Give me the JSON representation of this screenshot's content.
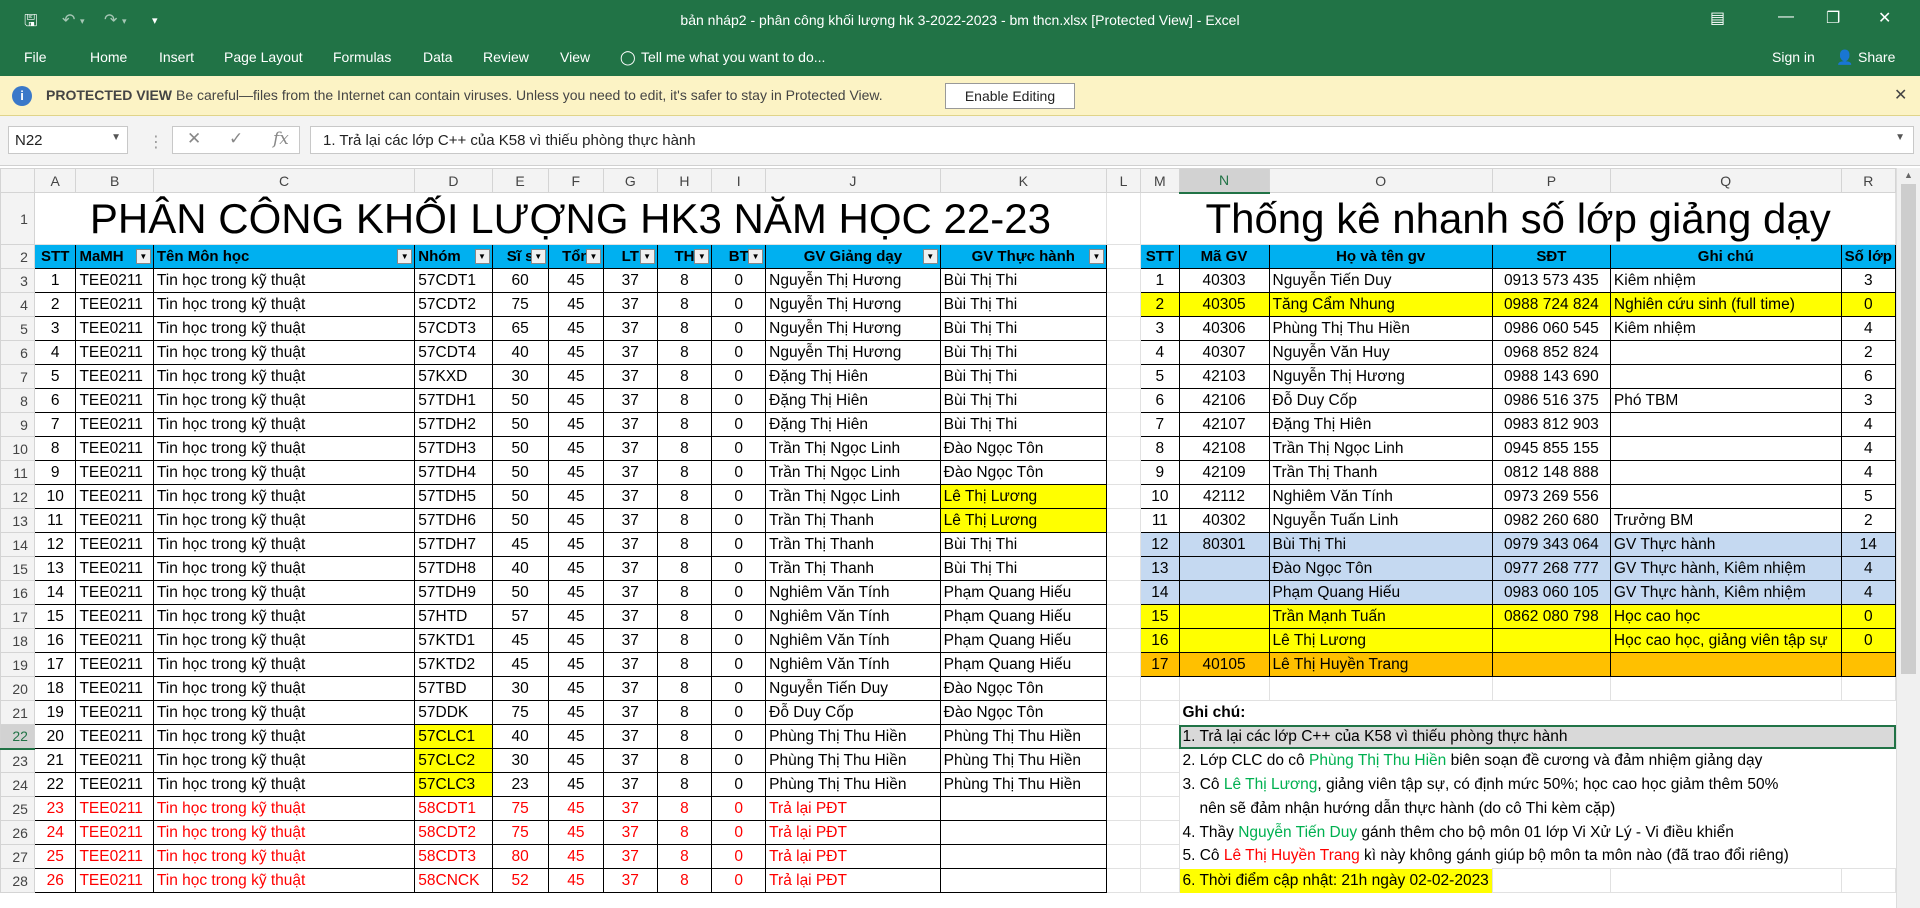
{
  "app": {
    "title": "bản nháp2 - phân công khối lượng hk 3-2022-2023 - bm thcn.xlsx  [Protected View] - Excel"
  },
  "ribbon": {
    "file": "File",
    "tabs": [
      "Home",
      "Insert",
      "Page Layout",
      "Formulas",
      "Data",
      "Review",
      "View"
    ],
    "tell": "Tell me what you want to do...",
    "signin": "Sign in",
    "share": "Share"
  },
  "protected": {
    "label": "PROTECTED VIEW",
    "message": "Be careful—files from the Internet can contain viruses. Unless you need to edit, it's safer to stay in Protected View.",
    "button": "Enable Editing"
  },
  "formula_bar": {
    "name_box": "N22",
    "fx": "fx",
    "content": "1. Trả lại các lớp C++ của K58 vì thiếu phòng thực hành"
  },
  "columns": [
    "A",
    "B",
    "C",
    "D",
    "E",
    "F",
    "G",
    "H",
    "I",
    "J",
    "K",
    "L",
    "M",
    "N",
    "O",
    "P",
    "Q",
    "R"
  ],
  "rows": [
    "1",
    "2",
    "3",
    "4",
    "5",
    "6",
    "7",
    "8",
    "9",
    "10",
    "11",
    "12",
    "13",
    "14",
    "15",
    "16",
    "17",
    "18",
    "19",
    "20",
    "21",
    "22",
    "23",
    "24",
    "25",
    "26",
    "27",
    "28"
  ],
  "title_left": "PHÂN CÔNG KHỐI LƯỢNG HK3 NĂM HỌC 22-23",
  "title_right": "Thống kê nhanh số lớp giảng dạy",
  "headers_left": [
    "STT",
    "MaMH",
    "Tên Môn học",
    "Nhóm",
    "Sĩ s",
    "Tổn",
    "LT",
    "TH",
    "BT",
    "GV Giảng dạy",
    "GV Thực hành"
  ],
  "headers_right": [
    "STT",
    "Mã GV",
    "Họ và tên gv",
    "SĐT",
    "Ghi chú",
    "Số lớp"
  ],
  "assignments": [
    [
      "1",
      "TEE0211",
      "Tin học trong kỹ thuật",
      "57CDT1",
      "60",
      "45",
      "37",
      "8",
      "0",
      "Nguyễn Thị Hương",
      "Bùi Thị Thi"
    ],
    [
      "2",
      "TEE0211",
      "Tin học trong kỹ thuật",
      "57CDT2",
      "75",
      "45",
      "37",
      "8",
      "0",
      "Nguyễn Thị Hương",
      "Bùi Thị Thi"
    ],
    [
      "3",
      "TEE0211",
      "Tin học trong kỹ thuật",
      "57CDT3",
      "65",
      "45",
      "37",
      "8",
      "0",
      "Nguyễn Thị Hương",
      "Bùi Thị Thi"
    ],
    [
      "4",
      "TEE0211",
      "Tin học trong kỹ thuật",
      "57CDT4",
      "40",
      "45",
      "37",
      "8",
      "0",
      "Nguyễn Thị Hương",
      "Bùi Thị Thi"
    ],
    [
      "5",
      "TEE0211",
      "Tin học trong kỹ thuật",
      "57KXD",
      "30",
      "45",
      "37",
      "8",
      "0",
      "Đặng Thị Hiên",
      "Bùi Thị Thi"
    ],
    [
      "6",
      "TEE0211",
      "Tin học trong kỹ thuật",
      "57TDH1",
      "50",
      "45",
      "37",
      "8",
      "0",
      "Đặng Thị Hiên",
      "Bùi Thị Thi"
    ],
    [
      "7",
      "TEE0211",
      "Tin học trong kỹ thuật",
      "57TDH2",
      "50",
      "45",
      "37",
      "8",
      "0",
      "Đặng Thị Hiên",
      "Bùi Thị Thi"
    ],
    [
      "8",
      "TEE0211",
      "Tin học trong kỹ thuật",
      "57TDH3",
      "50",
      "45",
      "37",
      "8",
      "0",
      "Trần Thị Ngọc Linh",
      "Đào Ngọc Tôn"
    ],
    [
      "9",
      "TEE0211",
      "Tin học trong kỹ thuật",
      "57TDH4",
      "50",
      "45",
      "37",
      "8",
      "0",
      "Trần Thị Ngọc Linh",
      "Đào Ngọc Tôn"
    ],
    [
      "10",
      "TEE0211",
      "Tin học trong kỹ thuật",
      "57TDH5",
      "50",
      "45",
      "37",
      "8",
      "0",
      "Trần Thị Ngọc Linh",
      "Lê Thị Lương"
    ],
    [
      "11",
      "TEE0211",
      "Tin học trong kỹ thuật",
      "57TDH6",
      "50",
      "45",
      "37",
      "8",
      "0",
      "Trần Thị Thanh",
      "Lê Thị Lương"
    ],
    [
      "12",
      "TEE0211",
      "Tin học trong kỹ thuật",
      "57TDH7",
      "45",
      "45",
      "37",
      "8",
      "0",
      "Trần Thị Thanh",
      "Bùi Thị Thi"
    ],
    [
      "13",
      "TEE0211",
      "Tin học trong kỹ thuật",
      "57TDH8",
      "40",
      "45",
      "37",
      "8",
      "0",
      "Trần Thị Thanh",
      "Bùi Thị Thi"
    ],
    [
      "14",
      "TEE0211",
      "Tin học trong kỹ thuật",
      "57TDH9",
      "50",
      "45",
      "37",
      "8",
      "0",
      "Nghiêm Văn Tính",
      "Phạm Quang Hiếu"
    ],
    [
      "15",
      "TEE0211",
      "Tin học trong kỹ thuật",
      "57HTD",
      "57",
      "45",
      "37",
      "8",
      "0",
      "Nghiêm Văn Tính",
      "Phạm Quang Hiếu"
    ],
    [
      "16",
      "TEE0211",
      "Tin học trong kỹ thuật",
      "57KTD1",
      "45",
      "45",
      "37",
      "8",
      "0",
      "Nghiêm Văn Tính",
      "Phạm Quang Hiếu"
    ],
    [
      "17",
      "TEE0211",
      "Tin học trong kỹ thuật",
      "57KTD2",
      "45",
      "45",
      "37",
      "8",
      "0",
      "Nghiêm Văn Tính",
      "Phạm Quang Hiếu"
    ],
    [
      "18",
      "TEE0211",
      "Tin học trong kỹ thuật",
      "57TBD",
      "30",
      "45",
      "37",
      "8",
      "0",
      "Nguyễn Tiến Duy",
      "Đào Ngọc Tôn"
    ],
    [
      "19",
      "TEE0211",
      "Tin học trong kỹ thuật",
      "57DDK",
      "75",
      "45",
      "37",
      "8",
      "0",
      "Đỗ Duy Cốp",
      "Đào Ngọc Tôn"
    ],
    [
      "20",
      "TEE0211",
      "Tin học trong kỹ thuật",
      "57CLC1",
      "40",
      "45",
      "37",
      "8",
      "0",
      "Phùng Thị Thu Hiền",
      "Phùng Thị Thu Hiền"
    ],
    [
      "21",
      "TEE0211",
      "Tin học trong kỹ thuật",
      "57CLC2",
      "30",
      "45",
      "37",
      "8",
      "0",
      "Phùng Thị Thu Hiền",
      "Phùng Thị Thu Hiền"
    ],
    [
      "22",
      "TEE0211",
      "Tin học trong kỹ thuật",
      "57CLC3",
      "23",
      "45",
      "37",
      "8",
      "0",
      "Phùng Thị Thu Hiền",
      "Phùng Thị Thu Hiền"
    ],
    [
      "23",
      "TEE0211",
      "Tin học trong kỹ thuật",
      "58CDT1",
      "75",
      "45",
      "37",
      "8",
      "0",
      "Trả lại PĐT",
      ""
    ],
    [
      "24",
      "TEE0211",
      "Tin học trong kỹ thuật",
      "58CDT2",
      "75",
      "45",
      "37",
      "8",
      "0",
      "Trả lại PĐT",
      ""
    ],
    [
      "25",
      "TEE0211",
      "Tin học trong kỹ thuật",
      "58CDT3",
      "80",
      "45",
      "37",
      "8",
      "0",
      "Trả lại PĐT",
      ""
    ],
    [
      "26",
      "TEE0211",
      "Tin học trong kỹ thuật",
      "58CNCK",
      "52",
      "45",
      "37",
      "8",
      "0",
      "Trả lại PĐT",
      ""
    ]
  ],
  "stats": [
    [
      "1",
      "40303",
      "Nguyễn Tiến Duy",
      "0913 573 435",
      "Kiêm nhiệm",
      "3"
    ],
    [
      "2",
      "40305",
      "Tăng Cẩm Nhung",
      "0988 724 824",
      "Nghiên cứu sinh (full time)",
      "0"
    ],
    [
      "3",
      "40306",
      "Phùng Thị Thu Hiền",
      "0986 060 545",
      "Kiêm nhiệm",
      "4"
    ],
    [
      "4",
      "40307",
      "Nguyễn Văn Huy",
      "0968 852 824",
      "",
      "2"
    ],
    [
      "5",
      "42103",
      "Nguyễn Thị Hương",
      "0988 143 690",
      "",
      "6"
    ],
    [
      "6",
      "42106",
      "Đỗ Duy Cốp",
      "0986 516 375",
      "Phó TBM",
      "3"
    ],
    [
      "7",
      "42107",
      "Đặng Thị Hiên",
      "0983 812 903",
      "",
      "4"
    ],
    [
      "8",
      "42108",
      "Trần Thị Ngọc Linh",
      "0945 855 155",
      "",
      "4"
    ],
    [
      "9",
      "42109",
      "Trần Thị Thanh",
      "0812 148 888",
      "",
      "4"
    ],
    [
      "10",
      "42112",
      "Nghiêm Văn Tính",
      "0973 269 556",
      "",
      "5"
    ],
    [
      "11",
      "40302",
      "Nguyễn Tuấn Linh",
      "0982 260 680",
      "Trưởng BM",
      "2"
    ],
    [
      "12",
      "80301",
      "Bùi Thị Thi",
      "0979 343 064",
      "GV Thực hành",
      "14"
    ],
    [
      "13",
      "",
      "Đào Ngọc Tôn",
      "0977 268 777",
      "GV Thực hành, Kiêm nhiệm",
      "4"
    ],
    [
      "14",
      "",
      "Phạm Quang Hiếu",
      "0983 060 105",
      "GV Thực hành, Kiêm nhiệm",
      "4"
    ],
    [
      "15",
      "",
      "Trần Mạnh Tuấn",
      "0862 080 798",
      "Học cao học",
      "0"
    ],
    [
      "16",
      "",
      "Lê Thị Lương",
      "",
      "Học cao học, giảng viên tập sự",
      "0"
    ],
    [
      "17",
      "40105",
      "Lê Thị Huyền Trang",
      "",
      "",
      ""
    ]
  ],
  "notes": {
    "title": "Ghi chú:",
    "n1": "1. Trả lại các lớp C++ của K58 vì thiếu phòng thực hành",
    "n2a": "2. Lớp CLC do cô ",
    "n2b": "Phùng Thị Thu Hiền",
    "n2c": " biên soạn đề cương và đảm nhiệm giảng dạy",
    "n3a": "3. Cô ",
    "n3b": "Lê Thị Lương",
    "n3c": ", giảng viên tập sự, có định mức 50%; học cao học giảm thêm 50%",
    "n3d": "nên sẽ đảm nhận hướng dẫn thực hành (do cô Thi kèm cặp)",
    "n4a": "4. Thầy ",
    "n4b": "Nguyễn Tiến Duy",
    "n4c": " gánh thêm cho bộ môn 01 lớp Vi Xử Lý - Vi điều khiển",
    "n5a": "5. Cô ",
    "n5b": "Lê Thị Huyền Trang",
    "n5c": "  kì này không gánh giúp bộ môn ta môn nào (đã trao đổi riêng)",
    "n6": "6. Thời điểm cập nhật: 21h ngày 02-02-2023"
  },
  "colors": {
    "excel_green": "#217346",
    "header_blue": "#00b0f0",
    "highlight_yellow": "#ffff00",
    "light_blue": "#c5d9f1",
    "orange": "#ffc000",
    "red_text": "#ff0000",
    "green_text": "#00b050"
  }
}
